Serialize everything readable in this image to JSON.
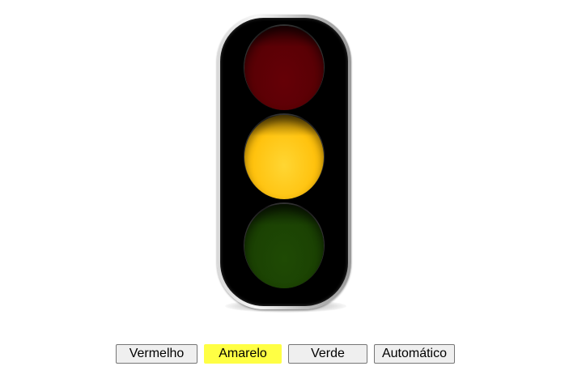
{
  "traffic_light": {
    "lamps": [
      {
        "name": "red",
        "state": "off"
      },
      {
        "name": "yellow",
        "state": "on"
      },
      {
        "name": "green",
        "state": "off"
      }
    ],
    "colors": {
      "red_off": "#5a0005",
      "yellow_on": "#ffc20e",
      "green_off": "#1b4203",
      "housing": "#000000"
    }
  },
  "controls": {
    "red_label": "Vermelho",
    "yellow_label": "Amarelo",
    "green_label": "Verde",
    "auto_label": "Automático",
    "active": "yellow",
    "active_color": "#ffff44"
  }
}
